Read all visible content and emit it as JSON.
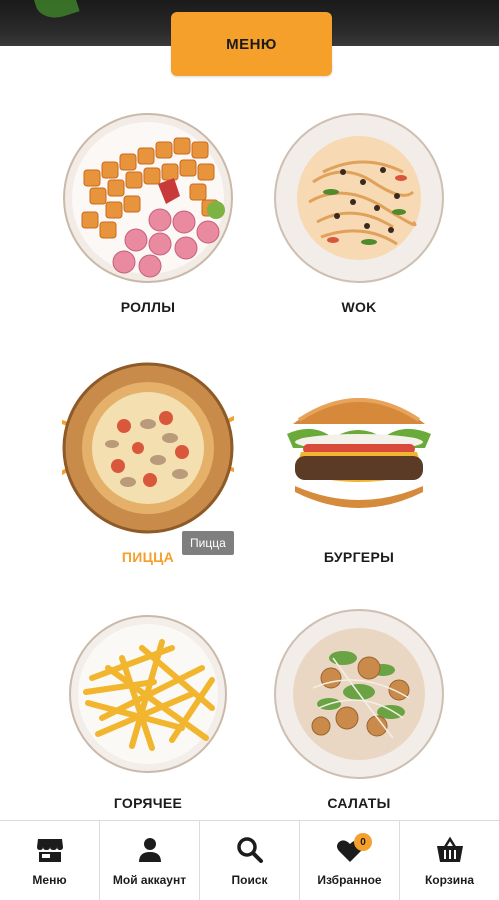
{
  "header": {
    "menu_button_label": "МЕНЮ"
  },
  "categories": [
    {
      "label": "РОЛЛЫ",
      "active": false
    },
    {
      "label": "WOK",
      "active": false
    },
    {
      "label": "ПИЦЦА",
      "active": true
    },
    {
      "label": "БУРГЕРЫ",
      "active": false
    },
    {
      "label": "ГОРЯЧЕЕ",
      "active": false
    },
    {
      "label": "САЛАТЫ",
      "active": false
    }
  ],
  "tooltip": {
    "text": "Пицца"
  },
  "bottom_nav": {
    "items": [
      {
        "label": "Меню",
        "icon": "storefront-icon"
      },
      {
        "label": "Мой аккаунт",
        "icon": "user-icon"
      },
      {
        "label": "Поиск",
        "icon": "search-icon"
      },
      {
        "label": "Избранное",
        "icon": "heart-icon",
        "badge": "0"
      },
      {
        "label": "Корзина",
        "icon": "basket-icon"
      }
    ]
  },
  "colors": {
    "accent": "#f5a02a",
    "text": "#1c1c1c",
    "tooltip_bg": "#7f7f7f"
  }
}
